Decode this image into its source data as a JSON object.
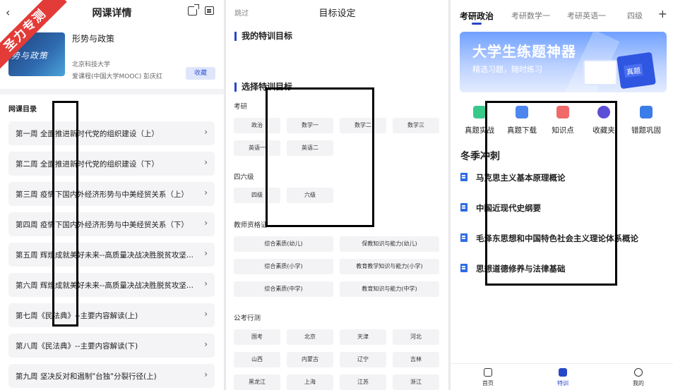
{
  "ribbon_text": "圣力专测",
  "panel1": {
    "title": "网课详情",
    "back_icon": "back-arrow-icon",
    "course": {
      "thumb_text": "势与政策",
      "name": "形势与政策",
      "school": "北京科技大学",
      "teacher": "爱课程(中国大学MOOC) 彭庆红",
      "collect_label": "收藏"
    },
    "catalog_title": "网课目录",
    "lessons": [
      "第一周 全面推进新时代党的组织建设（上）",
      "第二周 全面推进新时代党的组织建设（下）",
      "第三周 疫情下国内外经济形势与中美经贸关系（上）",
      "第四周 疫情下国内外经济形势与中美经贸关系（下）",
      "第五周 辉煌成就美好未来--高质量决战决胜脱贫攻坚...",
      "第六周 辉煌成就美好未来--高质量决战决胜脱贫攻坚...",
      "第七周《民法典》--主要内容解读(上)",
      "第八周《民法典》--主要内容解读(下)",
      "第九周 坚决反对和遏制\"台独\"分裂行径(上)"
    ]
  },
  "panel2": {
    "skip": "跳过",
    "title": "目标设定",
    "my_target": "我的特训目标",
    "choose_target": "选择特训目标",
    "groups": {
      "kaoyan": {
        "label": "考研",
        "chips": [
          "政治",
          "数学一",
          "数学二",
          "数学三",
          "英语一",
          "英语二"
        ]
      },
      "cet": {
        "label": "四六级",
        "chips": [
          "四级",
          "六级"
        ]
      },
      "teacher": {
        "label": "教师资格证",
        "chips": [
          "综合素质(幼儿)",
          "保教知识与能力(幼儿)",
          "综合素质(小学)",
          "教育教学知识与能力(小学)",
          "综合素质(中学)",
          "教育知识与能力(中学)"
        ]
      },
      "civil": {
        "label": "公考行测",
        "chips": [
          "国考",
          "北京",
          "天津",
          "河北",
          "山西",
          "内蒙古",
          "辽宁",
          "吉林",
          "黑龙江",
          "上海",
          "江苏",
          "浙江"
        ]
      }
    }
  },
  "panel3": {
    "tabs": [
      "考研政治",
      "考研数学一",
      "考研英语一",
      "四级"
    ],
    "banner": {
      "title": "大学生练题神器",
      "subtitle": "精选习题，随时练习",
      "book_label": "真题"
    },
    "features": [
      {
        "label": "真题实战",
        "icon": "exam-icon",
        "color": "#38c98a"
      },
      {
        "label": "真题下载",
        "icon": "download-icon",
        "color": "#4d86ef"
      },
      {
        "label": "知识点",
        "icon": "chart-icon",
        "color": "#f06a6a"
      },
      {
        "label": "收藏夹",
        "icon": "star-icon",
        "color": "#5b4fd6"
      },
      {
        "label": "错题巩固",
        "icon": "mistake-icon",
        "color": "#3b7de8"
      }
    ],
    "season_title": "冬季冲刺",
    "subjects": [
      "马克思主义基本原理概论",
      "中国近现代史纲要",
      "毛泽东思想和中国特色社会主义理论体系概论",
      "思想道德修养与法律基础"
    ],
    "nav": [
      "首页",
      "特训",
      "我的"
    ]
  }
}
